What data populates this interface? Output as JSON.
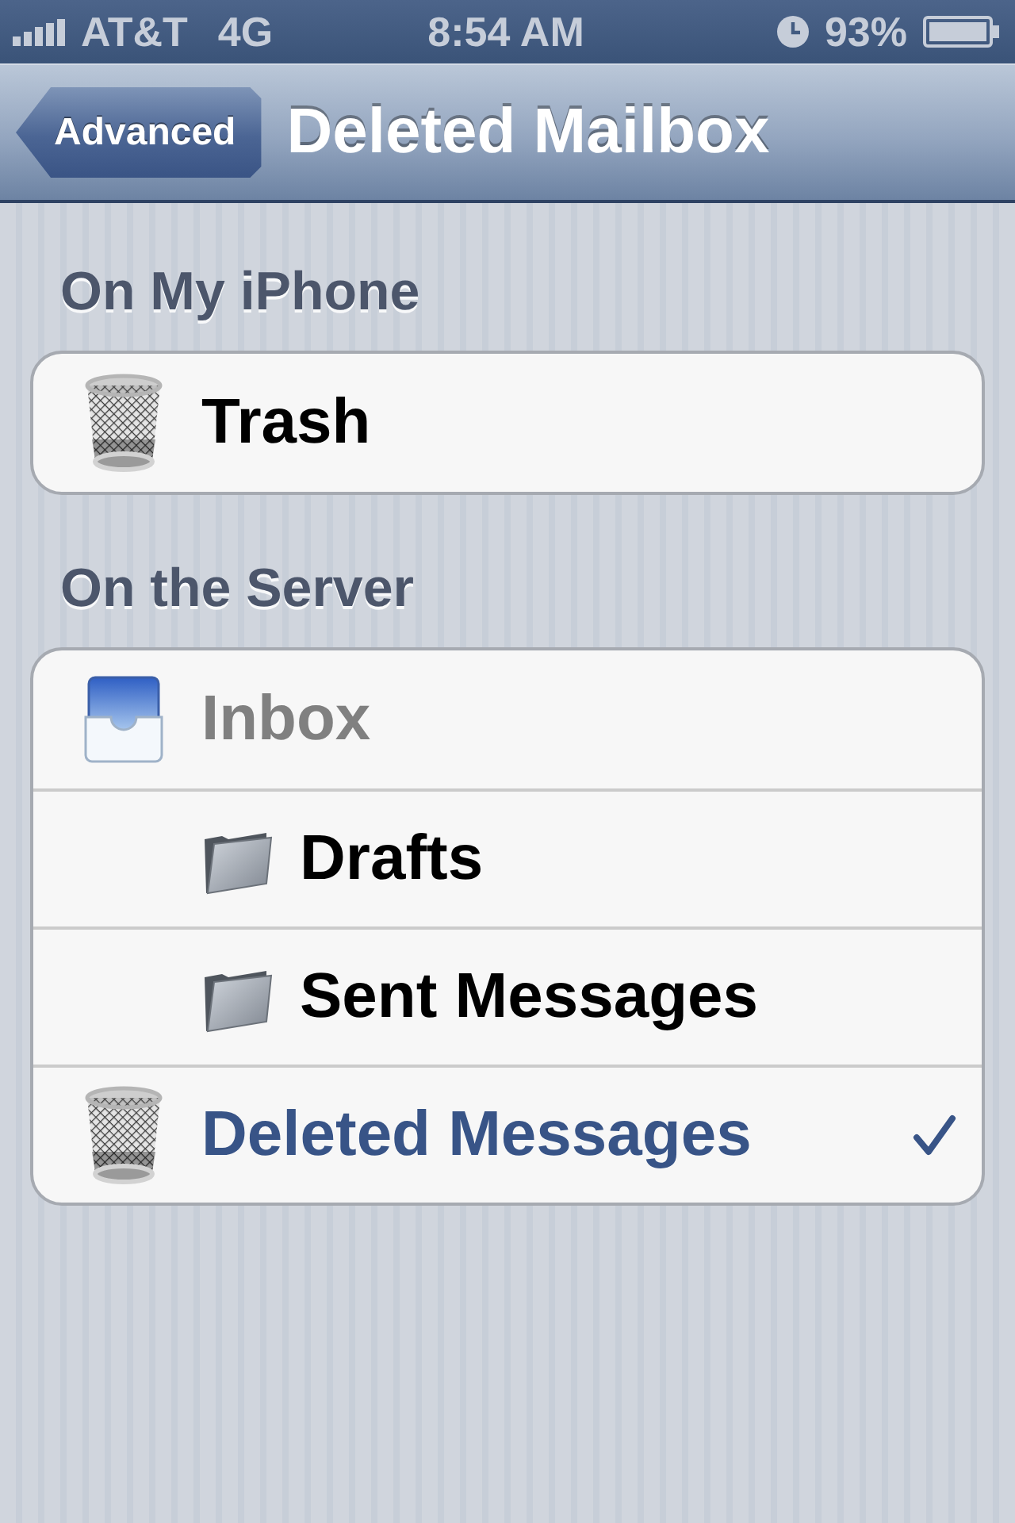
{
  "status_bar": {
    "carrier": "AT&T",
    "network": "4G",
    "time": "8:54 AM",
    "battery": "93%"
  },
  "nav_bar": {
    "back_button": "Advanced",
    "title": "Deleted Mailbox"
  },
  "sections": [
    {
      "header": "On My iPhone",
      "rows": [
        {
          "label": "Trash",
          "kind": "trash",
          "selected": false,
          "disabled": false
        }
      ]
    },
    {
      "header": "On the Server",
      "rows": [
        {
          "label": "Inbox",
          "kind": "inbox",
          "selected": false,
          "disabled": true,
          "children": [
            {
              "label": "Drafts",
              "kind": "folder",
              "selected": false,
              "disabled": false
            },
            {
              "label": "Sent Messages",
              "kind": "folder",
              "selected": false,
              "disabled": false
            }
          ]
        },
        {
          "label": "Deleted Messages",
          "kind": "trash",
          "selected": true,
          "disabled": false
        }
      ]
    }
  ]
}
